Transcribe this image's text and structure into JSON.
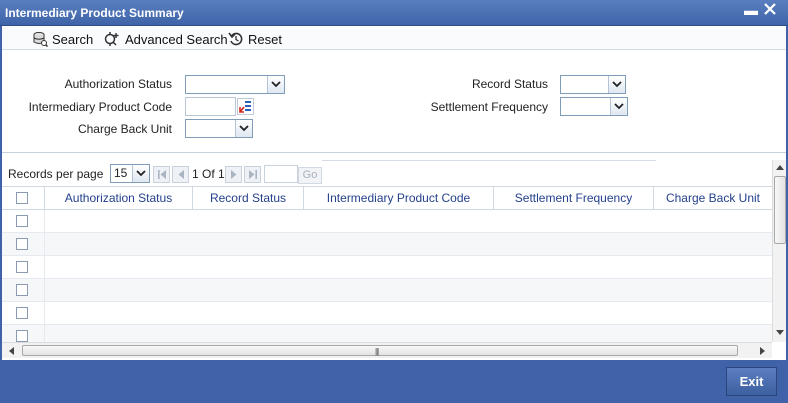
{
  "window": {
    "title": "Intermediary Product Summary"
  },
  "toolbar": {
    "search_label": "Search",
    "advanced_search_label": "Advanced Search",
    "reset_label": "Reset"
  },
  "criteria": {
    "authorization_status_label": "Authorization Status",
    "intermediary_product_code_label": "Intermediary Product Code",
    "charge_back_unit_label": "Charge Back Unit",
    "record_status_label": "Record Status",
    "settlement_frequency_label": "Settlement Frequency",
    "authorization_status_value": "",
    "intermediary_product_code_value": "",
    "charge_back_unit_value": "",
    "record_status_value": "",
    "settlement_frequency_value": ""
  },
  "pager": {
    "records_per_page_label": "Records per page",
    "records_per_page_value": "15",
    "page_info": "1 Of 1",
    "go_label": "Go"
  },
  "table": {
    "columns": [
      "Authorization Status",
      "Record Status",
      "Intermediary Product Code",
      "Settlement Frequency",
      "Charge Back Unit"
    ],
    "visible_empty_rows": 6
  },
  "footer": {
    "exit_label": "Exit"
  }
}
